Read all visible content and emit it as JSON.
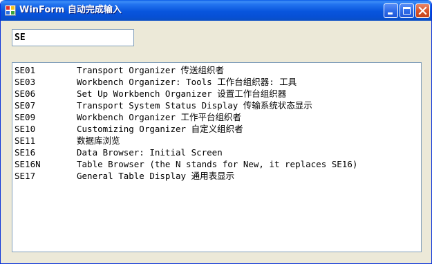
{
  "window": {
    "title": "WinForm 自动完成输入",
    "icon": "winform-app-icon"
  },
  "colors": {
    "titlebar": "#0855dd",
    "client_background": "#ece9d8",
    "input_border": "#7f9db9",
    "close_button": "#d9552b"
  },
  "search": {
    "value": "SE"
  },
  "list": {
    "items": [
      {
        "code": "SE01",
        "desc": "Transport Organizer 传送组织者"
      },
      {
        "code": "SE03",
        "desc": "Workbench Organizer: Tools 工作台组织器: 工具"
      },
      {
        "code": "SE06",
        "desc": "Set Up Workbench Organizer 设置工作台组织器"
      },
      {
        "code": "SE07",
        "desc": "Transport System Status Display 传输系统状态显示"
      },
      {
        "code": "SE09",
        "desc": "Workbench Organizer 工作平台组织者"
      },
      {
        "code": "SE10",
        "desc": "Customizing Organizer 自定义组织者"
      },
      {
        "code": "SE11",
        "desc": "数据库浏览"
      },
      {
        "code": "SE16",
        "desc": "Data Browser: Initial Screen"
      },
      {
        "code": "SE16N",
        "desc": "Table Browser (the N stands for New, it replaces SE16)"
      },
      {
        "code": "SE17",
        "desc": "General Table Display 通用表显示"
      }
    ]
  }
}
